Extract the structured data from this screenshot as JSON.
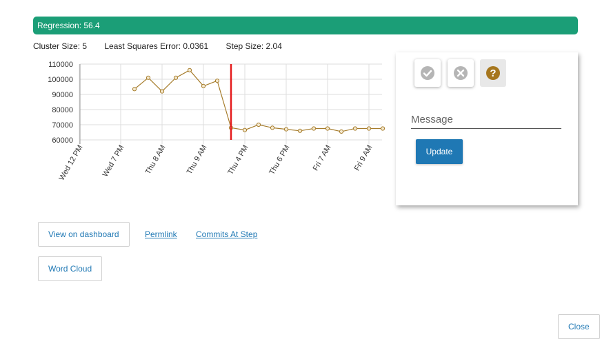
{
  "banner": {
    "text": "Regression: 56.4"
  },
  "stats": {
    "cluster_size": "Cluster Size: 5",
    "least_squares": "Least Squares Error: 0.0361",
    "step_size": "Step Size: 2.04"
  },
  "chart_data": {
    "type": "line",
    "title": "",
    "xlabel": "",
    "ylabel": "",
    "ylim": [
      60000,
      110000
    ],
    "y_ticks": [
      60000,
      70000,
      80000,
      90000,
      100000,
      110000
    ],
    "x_tick_labels": [
      "Wed 12 PM",
      "Wed 7 PM",
      "Thu 8 AM",
      "Thu 9 AM",
      "Thu 4 PM",
      "Thu 6 PM",
      "Fri 7 AM",
      "Fri 9 AM"
    ],
    "grid": true,
    "step_marker_index": 7,
    "series": [
      {
        "values": [
          93500,
          101000,
          92000,
          101000,
          106000,
          95500,
          99000,
          68000,
          66500,
          70000,
          68000,
          67000,
          66000,
          67500,
          67500,
          65500,
          67500,
          67500,
          67500
        ]
      }
    ],
    "colors": {
      "line": "#a67c2b",
      "step_marker": "#e41a1c",
      "grid": "#dddddd"
    }
  },
  "triage": {
    "positive_icon": "check-circle-icon",
    "negative_icon": "x-circle-icon",
    "untriaged_icon": "question-circle-icon",
    "message_placeholder": "Message",
    "update_label": "Update"
  },
  "actions": {
    "dashboard_label": "View on dashboard",
    "permlink_label": "Permlink",
    "commits_label": "Commits At Step",
    "word_cloud_label": "Word Cloud",
    "close_label": "Close"
  },
  "colors": {
    "banner": "#1b9e77",
    "accent": "#1f78b4",
    "untriaged": "#a6761d"
  }
}
